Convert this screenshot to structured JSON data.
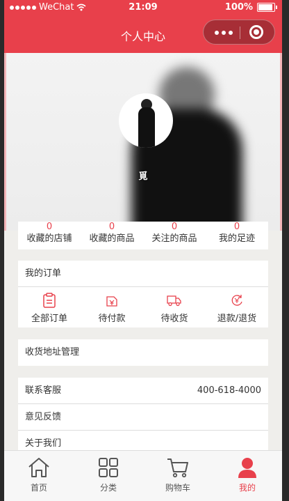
{
  "statusbar": {
    "carrier": "WeChat",
    "time": "21:09",
    "battery": "100%"
  },
  "navbar": {
    "title": "个人中心"
  },
  "profile": {
    "username": "覓"
  },
  "stats": [
    {
      "count": "0",
      "label": "收藏的店铺"
    },
    {
      "count": "0",
      "label": "收藏的商品"
    },
    {
      "count": "0",
      "label": "关注的商品"
    },
    {
      "count": "0",
      "label": "我的足迹"
    }
  ],
  "orders": {
    "title": "我的订单",
    "items": [
      {
        "label": "全部订单",
        "icon": "clipboard-icon"
      },
      {
        "label": "待付款",
        "icon": "payment-icon"
      },
      {
        "label": "待收货",
        "icon": "truck-icon"
      },
      {
        "label": "退款/退货",
        "icon": "refund-icon"
      }
    ]
  },
  "address": {
    "label": "收货地址管理"
  },
  "service": {
    "contact_label": "联系客服",
    "contact_phone": "400-618-4000",
    "feedback_label": "意见反馈",
    "about_label": "关于我们"
  },
  "tabbar": [
    {
      "label": "首页",
      "icon": "home-icon"
    },
    {
      "label": "分类",
      "icon": "category-icon"
    },
    {
      "label": "购物车",
      "icon": "cart-icon"
    },
    {
      "label": "我的",
      "icon": "user-icon",
      "active": true
    }
  ],
  "colors": {
    "accent": "#e8404b",
    "background": "#efeeeb"
  }
}
